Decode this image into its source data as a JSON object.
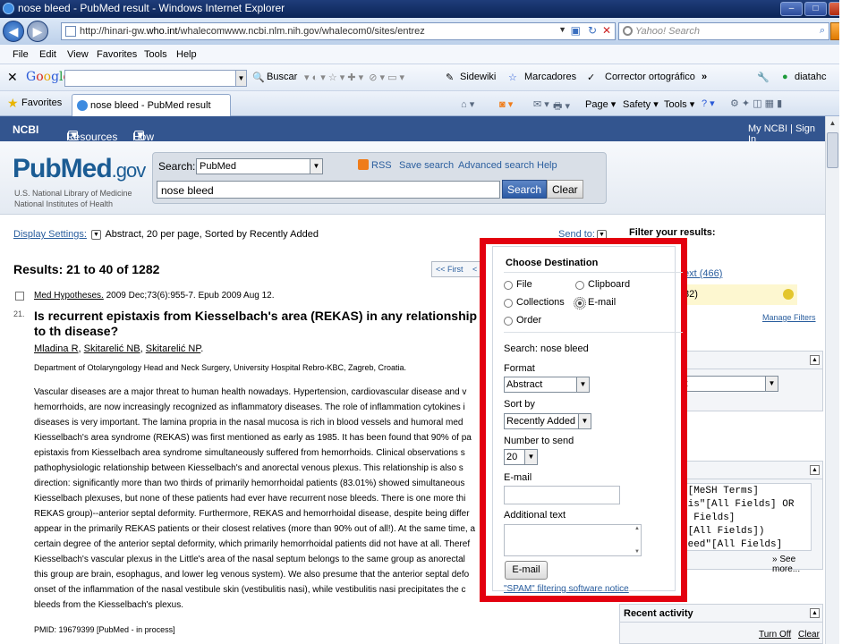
{
  "window": {
    "title": "nose bleed - PubMed result - Windows Internet Explorer"
  },
  "address": {
    "url_prefix": "http://hinari-gw.",
    "url_host": "who.int",
    "url_rest": "/whalecomwww.ncbi.nlm.nih.gov/whalecom0/sites/entrez",
    "search_placeholder": "Yahoo! Search"
  },
  "menu": {
    "items": [
      "File",
      "Edit",
      "View",
      "Favorites",
      "Tools",
      "Help"
    ]
  },
  "google_toolbar": {
    "buscar": "Buscar",
    "sidewiki": "Sidewiki",
    "marcadores": "Marcadores",
    "corrector": "Corrector ortográfico",
    "more": "»",
    "user": "diatahc"
  },
  "favbar": {
    "favorites": "Favorites",
    "tab_title": "nose bleed - PubMed result",
    "page": "Page",
    "safety": "Safety",
    "tools": "Tools"
  },
  "ncbi": {
    "logo": "NCBI",
    "resources": "Resources",
    "howto": "How To",
    "signin": "My NCBI | Sign In"
  },
  "pubmed": {
    "logo_pub": "Pub",
    "logo_med": "Med",
    "logo_gov": ".gov",
    "nlm_line1": "U.S. National Library of Medicine",
    "nlm_line2": "National Institutes of Health",
    "search_label": "Search:",
    "search_db": "PubMed",
    "rss": "RSS",
    "save_search": "Save search",
    "advanced": "Advanced search",
    "help": "Help",
    "query": "nose bleed",
    "search_btn": "Search",
    "clear_btn": "Clear"
  },
  "display": {
    "link": "Display Settings:",
    "text": "Abstract, 20 per page, Sorted by Recently Added",
    "sendto": "Send to:"
  },
  "results": {
    "title": "Results: 21 to 40 of 1282",
    "first": "<< First",
    "prev": "<"
  },
  "article": {
    "citation_journal": "Med Hypotheses.",
    "citation_rest": " 2009 Dec;73(6):955-7. Epub 2009 Aug 12.",
    "number": "21.",
    "title": "Is recurrent epistaxis from Kiesselbach's area (REKAS) in any relationship to th disease?",
    "author1": "Mladina R",
    "author2": "Skitarelić NB",
    "author3": "Skitarelić NP",
    "affiliation": "Department of Otolaryngology Head and Neck Surgery, University Hospital Rebro-KBC, Zagreb, Croatia.",
    "abstract_lines": [
      "Vascular diseases are a major threat to human health nowadays. Hypertension, cardiovascular disease and v",
      "hemorrhoids, are now increasingly recognized as inflammatory diseases. The role of inflammation cytokines i",
      "diseases is very important. The lamina propria in the nasal mucosa is rich in blood vessels and humoral med",
      "Kiesselbach's area syndrome (REKAS) was first mentioned as early as 1985. It has been found that 90% of pa",
      "epistaxis from Kiesselbach area syndrome simultaneously suffered from hemorrhoids. Clinical observations s",
      "pathophysiologic relationship between Kiesselbach's and anorectal venous plexus. This relationship is also s",
      "direction: significantly more than two thirds of primarily hemorrhoidal patients (83.01%) showed simultaneous",
      "Kiesselbach plexuses, but none of these patients had ever have recurrent nose bleeds. There is one more thi",
      "REKAS group)--anterior septal deformity. Furthermore, REKAS and hemorrhoidal disease, despite being differ",
      "appear in the primarily REKAS patients or their closest relatives (more than 90% out of all!). At the same time, a",
      "certain degree of the anterior septal deformity, which primarily hemorrhoidal patients did not have at all. Theref",
      "Kiesselbach's vascular plexus in the Little's area of the nasal septum belongs to the same group as anorectal",
      "this group are brain, esophagus, and lower leg venous system). We also presume that the anterior septal defo",
      "onset of the inflammation of the nasal vestibule skin (vestibulitis nasi), while vestibulitis nasi precipitates the c",
      "bleeds from the Kiesselbach's plexus."
    ],
    "pmid": "PMID: 19679399 [PubMed - in process]"
  },
  "right": {
    "filter_title": "Filter your results:",
    "filter1": "ext (466)",
    "filter2": "82)",
    "manage": "Manage Filters",
    "box1_title": "a",
    "box1_select": "ct",
    "box2_lines": [
      "\"[MeSH Terms]",
      "xis\"[All Fields] OR",
      "l Fields]",
      "\"[All Fields])",
      "leed\"[All Fields]"
    ],
    "see_more": "» See more...",
    "recent": "Recent activity",
    "turn_off": "Turn Off",
    "clear": "Clear"
  },
  "dest": {
    "title": "Choose Destination",
    "opt_file": "File",
    "opt_clipboard": "Clipboard",
    "opt_collections": "Collections",
    "opt_email": "E-mail",
    "opt_order": "Order",
    "search_text": "Search: nose bleed",
    "format_label": "Format",
    "format_value": "Abstract",
    "sort_label": "Sort by",
    "sort_value": "Recently Added",
    "number_label": "Number to send",
    "number_value": "20",
    "email_label": "E-mail",
    "additional_label": "Additional text",
    "email_button": "E-mail",
    "spam_link": "\"SPAM\" filtering software notice"
  },
  "colors": {
    "highlight_border": "#e3000f",
    "ncbi_bar": "#33558f",
    "link": "#2a5e9e"
  }
}
